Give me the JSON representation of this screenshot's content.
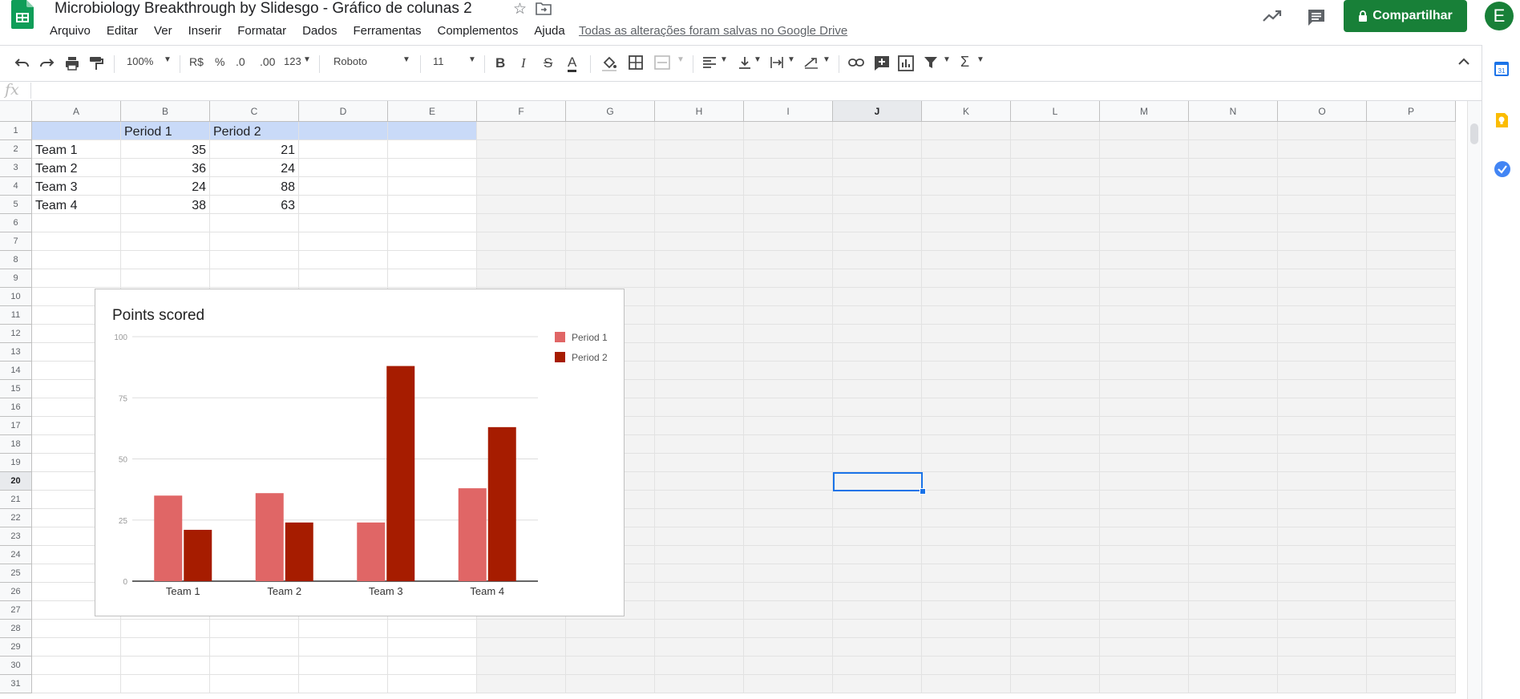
{
  "header": {
    "title": "Microbiology Breakthrough by Slidesgo - Gráfico de colunas 2",
    "save_status": "Todas as alterações foram salvas no Google Drive",
    "share_label": "Compartilhar",
    "avatar_letter": "E",
    "brand_color": "#188038"
  },
  "menu": [
    "Arquivo",
    "Editar",
    "Ver",
    "Inserir",
    "Formatar",
    "Dados",
    "Ferramentas",
    "Complementos",
    "Ajuda"
  ],
  "toolbar": {
    "zoom": "100%",
    "currency": "R$",
    "percent": "%",
    "dec_decrease": ".0",
    "dec_increase": ".00",
    "more_formats": "123",
    "font": "Roboto",
    "font_size": "11"
  },
  "formula_bar": {
    "label": "fx"
  },
  "sheet": {
    "columns": [
      "A",
      "B",
      "C",
      "D",
      "E",
      "F",
      "G",
      "H",
      "I",
      "J",
      "K",
      "L",
      "M",
      "N",
      "O",
      "P"
    ],
    "selected_column": "J",
    "row_count": 31,
    "selected_row": 20,
    "selected_cell": "J20",
    "cells": [
      [
        "",
        "Period 1",
        "Period 2"
      ],
      [
        "Team 1",
        "35",
        "21"
      ],
      [
        "Team 2",
        "36",
        "24"
      ],
      [
        "Team 3",
        "24",
        "88"
      ],
      [
        "Team 4",
        "38",
        "63"
      ]
    ]
  },
  "chart_data": {
    "type": "bar",
    "title": "Points scored",
    "categories": [
      "Team 1",
      "Team 2",
      "Team 3",
      "Team 4"
    ],
    "series": [
      {
        "name": "Period 1",
        "values": [
          35,
          36,
          24,
          38
        ],
        "color": "#e06666"
      },
      {
        "name": "Period 2",
        "values": [
          21,
          24,
          88,
          63
        ],
        "color": "#a61c00"
      }
    ],
    "ylim": [
      0,
      100
    ],
    "yticks": [
      0,
      25,
      50,
      75,
      100
    ],
    "grid": true,
    "legend_position": "right"
  },
  "side_panel": {
    "icons": [
      "calendar-icon",
      "keep-icon",
      "tasks-icon"
    ],
    "calendar_label": "31"
  }
}
